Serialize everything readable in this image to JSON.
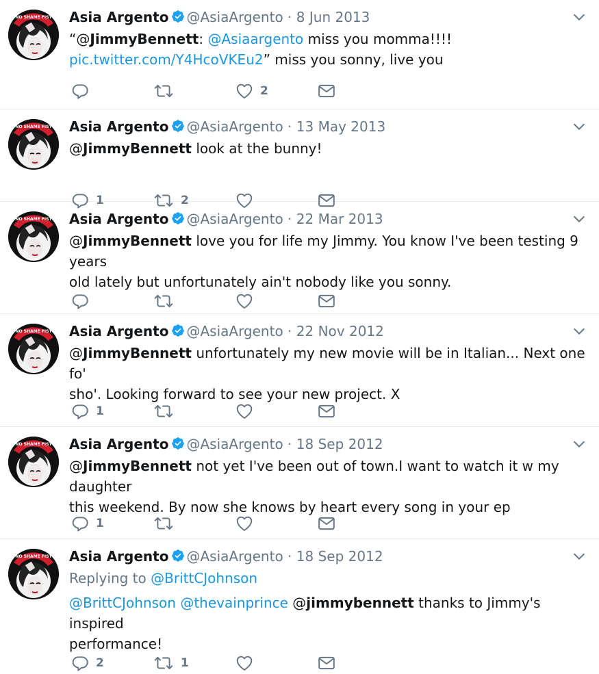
{
  "author": {
    "name": "Asia Argento",
    "handle": "@AsiaArgento"
  },
  "colors": {
    "link": "#1b95e0",
    "muted": "#657786",
    "text": "#14171a",
    "border": "#e6ecf0"
  },
  "icons": {
    "reply": "reply-icon",
    "retweet": "retweet-icon",
    "like": "heart-icon",
    "dm": "envelope-icon",
    "verified": "verified-badge-icon",
    "menu": "chevron-down-icon"
  },
  "tweets": [
    {
      "date": "8 Jun 2013",
      "lines": [
        [
          {
            "t": "“"
          },
          {
            "t": "@",
            "c": "bold-at"
          },
          {
            "t": "JimmyBennett",
            "c": "bold"
          },
          {
            "t": ": "
          },
          {
            "t": "@Asiaargento",
            "c": "mention"
          },
          {
            "t": " miss you momma!!!!"
          }
        ],
        [
          {
            "t": "pic.twitter.com/Y4HcoVKEu2",
            "c": "link"
          },
          {
            "t": "” miss you sonny, live you"
          }
        ]
      ],
      "replies": "",
      "retweets": "",
      "likes": "2"
    },
    {
      "date": "13 May 2013",
      "lines": [
        [
          {
            "t": "@",
            "c": "bold-at"
          },
          {
            "t": "JimmyBennett",
            "c": "bold"
          },
          {
            "t": " look at the bunny!"
          }
        ]
      ],
      "replies": "1",
      "retweets": "2",
      "likes": ""
    },
    {
      "date": "22 Mar 2013",
      "lines": [
        [
          {
            "t": "@",
            "c": "bold-at"
          },
          {
            "t": "JimmyBennett",
            "c": "bold"
          },
          {
            "t": " love you for life my Jimmy. You know I've been testing 9 years"
          }
        ],
        [
          {
            "t": "old lately but unfortunately ain't nobody like you sonny."
          }
        ]
      ],
      "replies": "",
      "retweets": "",
      "likes": ""
    },
    {
      "date": "22 Nov 2012",
      "lines": [
        [
          {
            "t": "@",
            "c": "bold-at"
          },
          {
            "t": "JimmyBennett",
            "c": "bold"
          },
          {
            "t": " unfortunately my new movie will be in Italian... Next one fo'"
          }
        ],
        [
          {
            "t": "sho'. Looking forward to see your new project. X"
          }
        ]
      ],
      "replies": "1",
      "retweets": "",
      "likes": ""
    },
    {
      "date": "18 Sep 2012",
      "lines": [
        [
          {
            "t": "@",
            "c": "bold-at"
          },
          {
            "t": "JimmyBennett",
            "c": "bold"
          },
          {
            "t": " not yet I've been out of town.I want to watch it w my daughter"
          }
        ],
        [
          {
            "t": "this weekend. By now she knows by heart every song in your ep"
          }
        ]
      ],
      "replies": "1",
      "retweets": "",
      "likes": ""
    },
    {
      "date": "18 Sep 2012",
      "replying_label": "Replying to ",
      "replying_to": "@BrittCJohnson",
      "lines": [
        [
          {
            "t": "@BrittCJohnson",
            "c": "mention"
          },
          {
            "t": " "
          },
          {
            "t": "@thevainprince",
            "c": "mention"
          },
          {
            "t": " "
          },
          {
            "t": "@",
            "c": "bold-at"
          },
          {
            "t": "jimmybennett",
            "c": "bold"
          },
          {
            "t": " thanks to Jimmy's inspired"
          }
        ],
        [
          {
            "t": "performance!"
          }
        ]
      ],
      "replies": "2",
      "retweets": "1",
      "likes": ""
    }
  ]
}
